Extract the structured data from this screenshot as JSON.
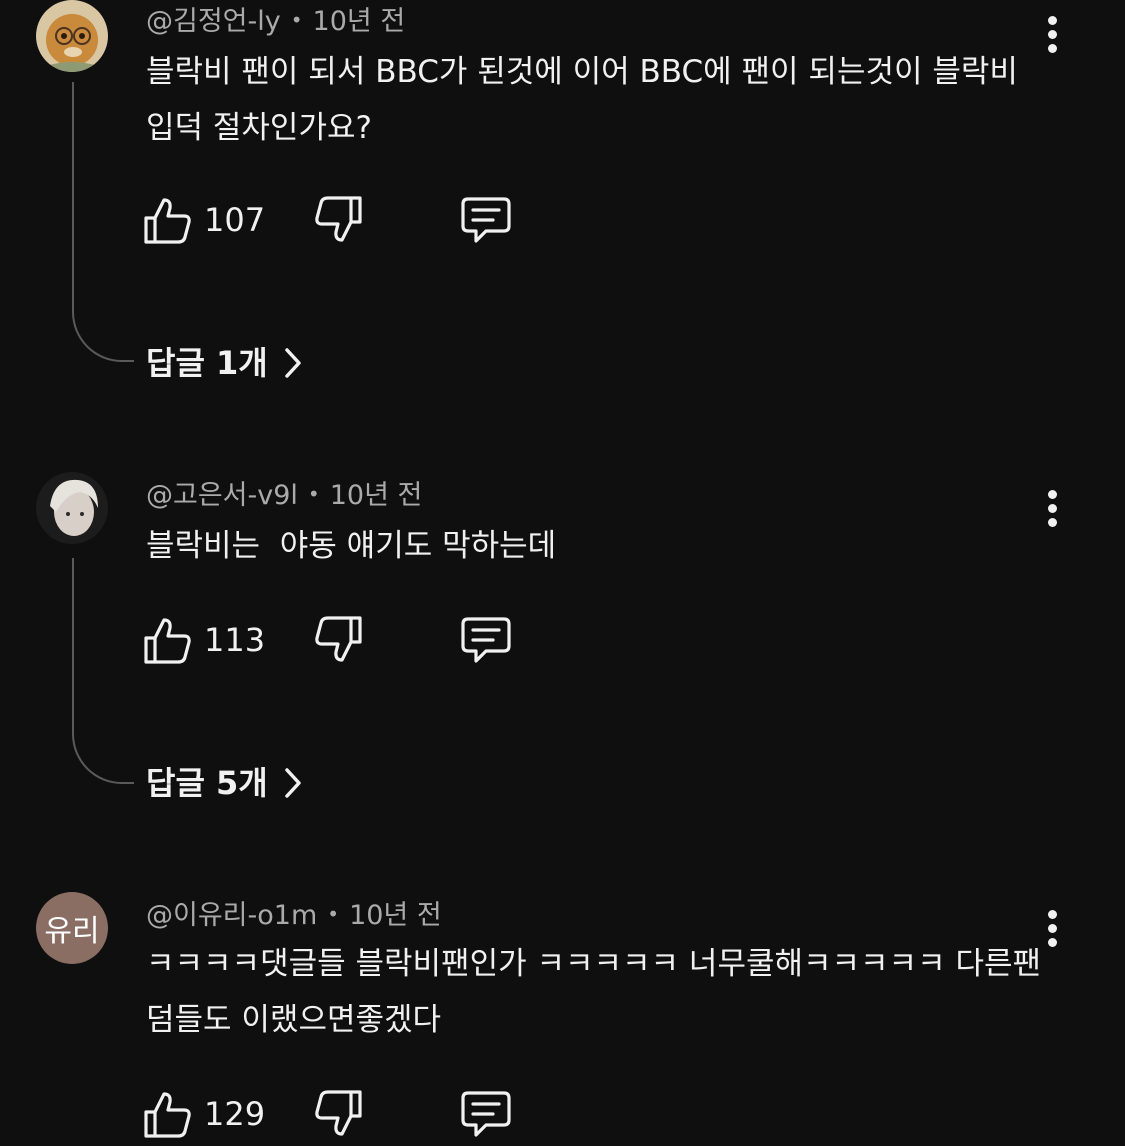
{
  "comments": [
    {
      "author": "@김정언-ly",
      "time": "10년 전",
      "text": "블락비 팬이 되서 BBC가 된것에 이어 BBC에 팬이 되는것이 블락비 입덕 절차인가요?",
      "likes": "107",
      "replies_label": "답글 1개",
      "avatar_icon": "cartoon-avatar-icon"
    },
    {
      "author": "@고은서-v9l",
      "time": "10년 전",
      "text": "블락비는  야동 얘기도 막하는데",
      "likes": "113",
      "replies_label": "답글 5개",
      "avatar_icon": "photo-avatar-icon"
    },
    {
      "author": "@이유리-o1m",
      "time": "10년 전",
      "text": "ㅋㅋㅋㅋ댓글들 블락비팬인가 ㅋㅋㅋㅋㅋ 너무쿨해ㅋㅋㅋㅋㅋ 다른팬덤들도 이랬으면좋겠다",
      "likes": "129",
      "avatar_text": "유리",
      "avatar_color": "#8a6e64"
    }
  ],
  "separator": "•",
  "icons": {
    "like": "thumb-up-icon",
    "dislike": "thumb-down-icon",
    "reply": "comment-icon",
    "more": "more-vert-icon",
    "chevron": "chevron-right-icon"
  },
  "colors": {
    "background": "#0f0f0f",
    "text": "#f1f1f1",
    "secondary_text": "#aaaaaa",
    "thread_line": "#5a5a5a"
  }
}
